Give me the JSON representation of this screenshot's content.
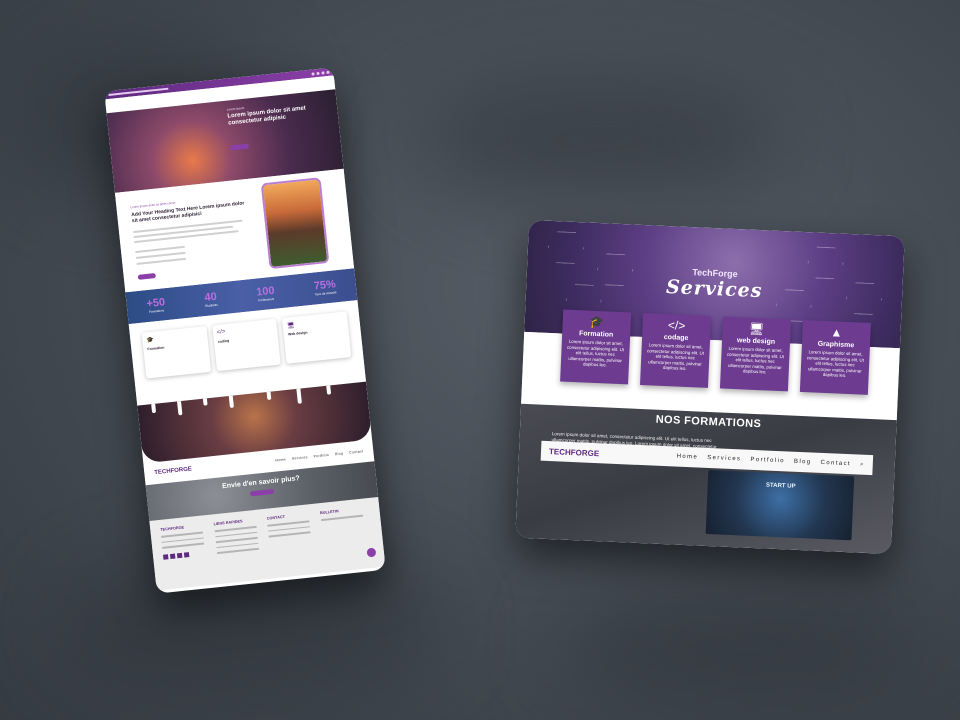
{
  "phone": {
    "hero": {
      "kicker": "Lorem Ipsum",
      "title": "Lorem ipsum dolor sit amet consectetur adipisic"
    },
    "about": {
      "kicker": "Lorem ipsum dolor sit amet conse",
      "title": "Add Your Heading Text Here Lorem ipsum dolor sit amet consectetur adipisici"
    },
    "stats": [
      {
        "number": "+50",
        "label": "Formations"
      },
      {
        "number": "40",
        "label": "Etudiants"
      },
      {
        "number": "100",
        "label": "Professeurs"
      },
      {
        "number": "75%",
        "label": "Taux de réussite"
      }
    ],
    "cards": [
      {
        "icon": "🎓",
        "title": "Formation"
      },
      {
        "icon": "</>",
        "title": "coding"
      },
      {
        "icon": "🖥",
        "title": "Web design"
      }
    ],
    "nav": {
      "logo": "TECHFORGE",
      "items": [
        "Home",
        "Services",
        "Portfolio",
        "Blog",
        "Contact"
      ]
    },
    "cta": {
      "title": "Envie d'en savoir plus?"
    },
    "footer": {
      "columns": [
        "TECHFORGE",
        "LIENS RAPIDES",
        "CONTACT",
        "BULLETIN"
      ]
    }
  },
  "tablet": {
    "hero": {
      "kicker": "TechForge",
      "title": "Services"
    },
    "cards": [
      {
        "icon": "🎓",
        "title": "Formation",
        "body": "Lorem ipsum dolor sit amet, consectetur adipiscing elit. Ut elit tellus, luctus nec ullamcorper mattis, pulvinar dapibus leo."
      },
      {
        "icon": "</>",
        "title": "codage",
        "body": "Lorem ipsum dolor sit amet, consectetur adipiscing elit. Ut elit tellus, luctus nec ullamcorper mattis, pulvinar dapibus leo."
      },
      {
        "icon": "🖥",
        "title": "web design",
        "body": "Lorem ipsum dolor sit amet, consectetur adipiscing elit. Ut elit tellus, luctus nec ullamcorper mattis, pulvinar dapibus leo."
      },
      {
        "icon": "▲",
        "title": "Graphisme",
        "body": "Lorem ipsum dolor sit amet, consectetur adipiscing elit. Ut elit tellus, luctus nec ullamcorper mattis, pulvinar dapibus leo."
      }
    ],
    "formations": {
      "title": "NOS FORMATIONS",
      "paragraph": "Lorem ipsum dolor sit amet, consectetur adipiscing elit. Ut elit tellus, luctus nec ullamcorper mattis, pulvinar dapibus leo. Lorem ipsum dolor sit amet, consectetur adipiscing elit. Ut elit tellus, luctus nec ullamcorper mattis, pulvinar dapibus leo. Lorem ipsum dolor sit amet, consectetur adipiscing elit. Ut elit tellus, luctus nec ullamcorper mattis, pulvinar dapibus leo.",
      "image_label": "START UP"
    },
    "nav": {
      "logo": "TECHFORGE",
      "items": [
        "Home",
        "Services",
        "Portfolio",
        "Blog",
        "Contact"
      ]
    }
  }
}
